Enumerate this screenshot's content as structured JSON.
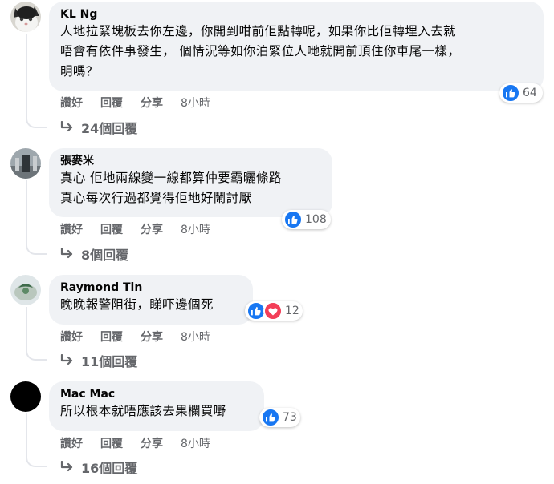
{
  "actions": {
    "like": "讚好",
    "reply": "回覆",
    "share": "分享"
  },
  "comments": [
    {
      "author": "KL Ng",
      "text": "人地拉緊塊板去你左邊，你開到咁前佢點轉呢，如果你比佢轉埋入去就\n唔會有依件事發生， 個情況等如你泊緊位人哋就開前頂住你車尾一樣，\n明嗎？",
      "reaction_count": "64",
      "time": "8小時",
      "replies": "24個回覆"
    },
    {
      "author": "張麥米",
      "text": "真心 佢地兩線變一線都算仲要霸曬條路\n真心每次行過都覺得佢地好鬧討厭",
      "reaction_count": "108",
      "time": "8小時",
      "replies": "8個回覆"
    },
    {
      "author": "Raymond Tin",
      "text": "晚晚報警阻街，睇吓邊個死",
      "reaction_count": "12",
      "time": "8小時",
      "replies": "11個回覆"
    },
    {
      "author": "Mac Mac",
      "text": "所以根本就唔應該去果欄買嘢",
      "reaction_count": "73",
      "time": "8小時",
      "replies": "16個回覆"
    }
  ],
  "colors": {
    "like": "#1877f2",
    "love": "#f33e58",
    "bubble": "#f0f2f5",
    "meta": "#65676b"
  }
}
